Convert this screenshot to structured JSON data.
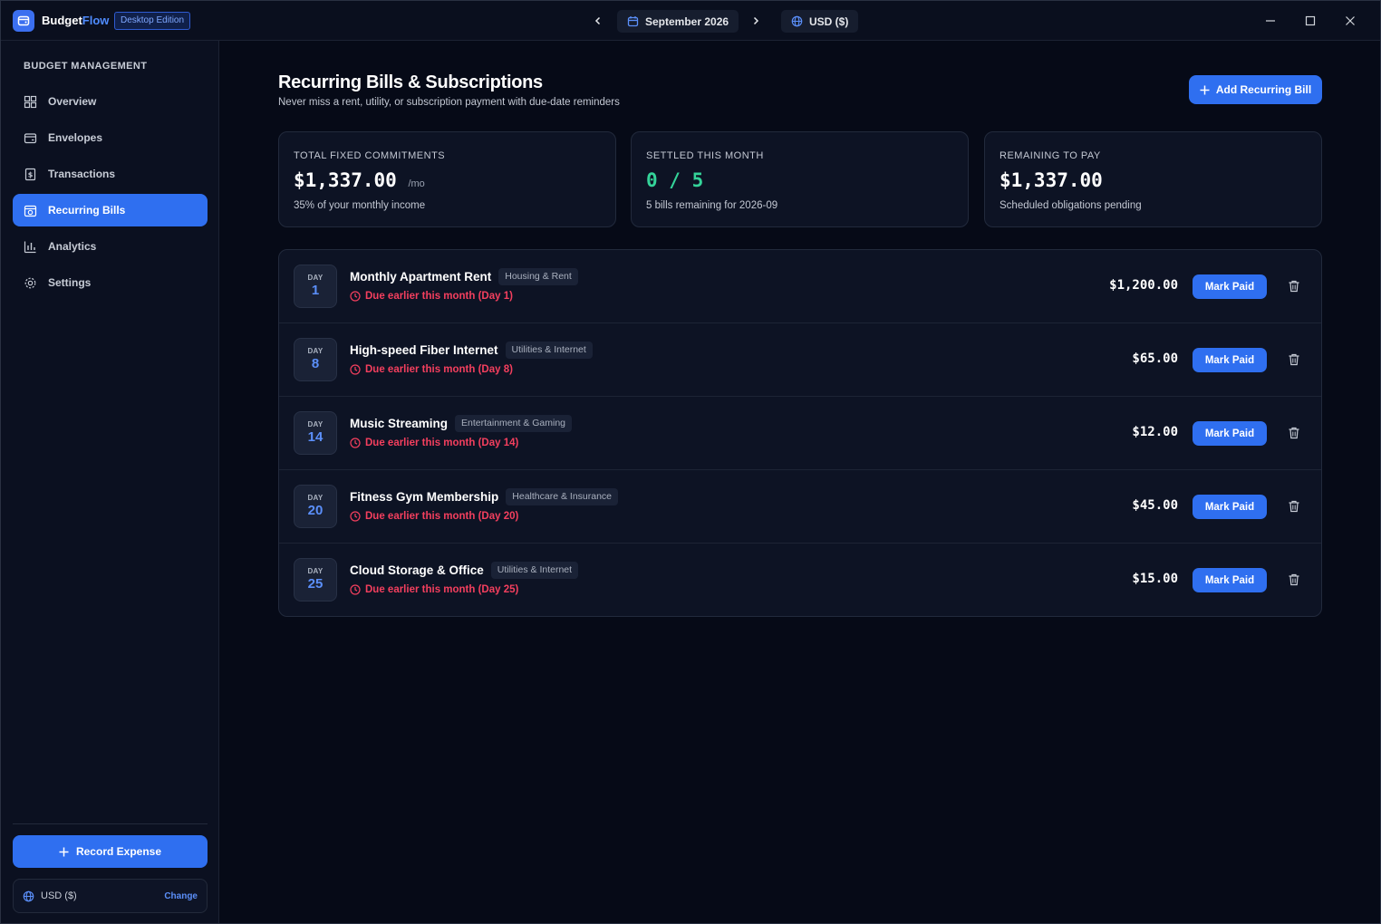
{
  "app": {
    "name_prefix": "Budget",
    "name_suffix": "Flow",
    "edition": "Desktop Edition"
  },
  "titlebar": {
    "month": "September 2026",
    "currency": "USD ($)"
  },
  "sidebar": {
    "heading": "BUDGET MANAGEMENT",
    "items": [
      {
        "label": "Overview",
        "icon": "grid-icon"
      },
      {
        "label": "Envelopes",
        "icon": "envelope-icon"
      },
      {
        "label": "Transactions",
        "icon": "receipt-icon"
      },
      {
        "label": "Recurring Bills",
        "icon": "calendar-repeat-icon",
        "active": true
      },
      {
        "label": "Analytics",
        "icon": "bar-chart-icon"
      },
      {
        "label": "Settings",
        "icon": "gear-icon"
      }
    ],
    "record_label": "Record Expense",
    "currency_label": "USD ($)",
    "change_label": "Change"
  },
  "main": {
    "title": "Recurring Bills & Subscriptions",
    "subtitle": "Never miss a rent, utility, or subscription payment with due-date reminders",
    "add_label": "Add Recurring Bill",
    "stats": [
      {
        "label": "TOTAL FIXED COMMITMENTS",
        "value": "$1,337.00",
        "unit": "/mo",
        "note": "35% of your monthly income"
      },
      {
        "label": "SETTLED THIS MONTH",
        "value": "0 / 5",
        "unit": "",
        "note": "5 bills remaining for 2026-09"
      },
      {
        "label": "REMAINING TO PAY",
        "value": "$1,337.00",
        "unit": "",
        "note": "Scheduled obligations pending"
      }
    ],
    "day_label": "DAY",
    "mark_paid_label": "Mark Paid",
    "bills": [
      {
        "day": "1",
        "name": "Monthly Apartment Rent",
        "category": "Housing & Rent",
        "due": "Due earlier this month (Day 1)",
        "amount": "$1,200.00"
      },
      {
        "day": "8",
        "name": "High-speed Fiber Internet",
        "category": "Utilities & Internet",
        "due": "Due earlier this month (Day 8)",
        "amount": "$65.00"
      },
      {
        "day": "14",
        "name": "Music Streaming",
        "category": "Entertainment & Gaming",
        "due": "Due earlier this month (Day 14)",
        "amount": "$12.00"
      },
      {
        "day": "20",
        "name": "Fitness Gym Membership",
        "category": "Healthcare & Insurance",
        "due": "Due earlier this month (Day 20)",
        "amount": "$45.00"
      },
      {
        "day": "25",
        "name": "Cloud Storage & Office",
        "category": "Utilities & Internet",
        "due": "Due earlier this month (Day 25)",
        "amount": "$15.00"
      }
    ]
  },
  "colors": {
    "accent": "#2f6ff0",
    "positive": "#34d399",
    "overdue": "#f43f5e",
    "background": "#060a17"
  }
}
